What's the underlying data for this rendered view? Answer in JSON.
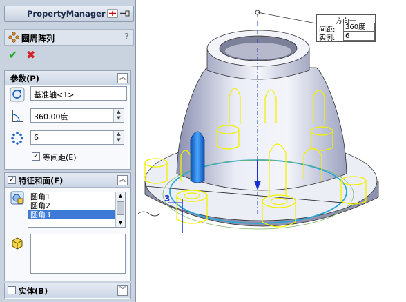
{
  "pm": {
    "title": "PropertyManager",
    "feature_name": "圆周阵列",
    "help": "?",
    "ok_glyph": "✔",
    "cancel_glyph": "✖",
    "params": {
      "title": "参数(P)",
      "axis": "基准轴<1>",
      "angle": "360.00度",
      "count": "6",
      "equal_spacing": "等间距(E)"
    },
    "features": {
      "title": "特征和面(F)",
      "items": [
        "圆角1",
        "圆角2",
        "圆角3"
      ]
    },
    "bodies": {
      "title": "实体(B)"
    }
  },
  "callout": {
    "title": "方向一",
    "spacing_label": "间距:",
    "spacing_value": "360度",
    "count_label": "实例:",
    "count_value": "6"
  },
  "view": {
    "dim_label": "3"
  },
  "colors": {
    "panel_bg": "#c9d3e0",
    "wire_yellow": "#f2f200",
    "selection_blue": "#1a6fd1",
    "accent_list_select": "#3d79d6"
  }
}
